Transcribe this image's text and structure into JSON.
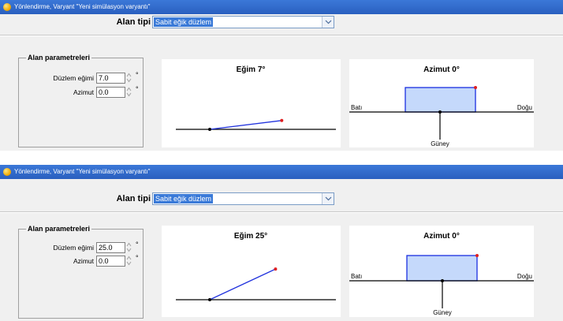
{
  "panels": [
    {
      "window_title": "Yönlendirme, Varyant \"Yeni simülasyon varyantı\"",
      "field_type_label": "Alan tipi",
      "field_type_value": "Sabit eğik düzlem",
      "group_title": "Alan parametreleri",
      "tilt_label": "Düzlem eğimi",
      "tilt_value": "7.0",
      "azimuth_label": "Azimut",
      "azimuth_value": "0.0",
      "unit_symbol": "°",
      "tilt_chart_title": "Eğim 7°",
      "tilt_degrees": 7,
      "azimuth_chart_title": "Azimut 0°",
      "azimuth_degrees": 0,
      "compass_west": "Batı",
      "compass_east": "Doğu",
      "compass_south": "Güney"
    },
    {
      "window_title": "Yönlendirme, Varyant \"Yeni simülasyon varyantı\"",
      "field_type_label": "Alan tipi",
      "field_type_value": "Sabit eğik düzlem",
      "group_title": "Alan parametreleri",
      "tilt_label": "Düzlem eğimi",
      "tilt_value": "25.0",
      "azimuth_label": "Azimut",
      "azimuth_value": "0.0",
      "unit_symbol": "°",
      "tilt_chart_title": "Eğim 25°",
      "tilt_degrees": 25,
      "azimuth_chart_title": "Azimut 0°",
      "azimuth_degrees": 0,
      "compass_west": "Batı",
      "compass_east": "Doğu",
      "compass_south": "Güney"
    }
  ],
  "icons": [
    "app-sun-icon",
    "chevron-down-icon",
    "spinner-up-icon",
    "spinner-down-icon"
  ],
  "colors": {
    "title_bar": "#2f66c7",
    "selection": "#3a7ad8",
    "plane_line": "#2233dd",
    "plane_edge_point": "#e02020",
    "panel_fill": "#c5d9fb",
    "panel_border": "#1a2ee0"
  }
}
